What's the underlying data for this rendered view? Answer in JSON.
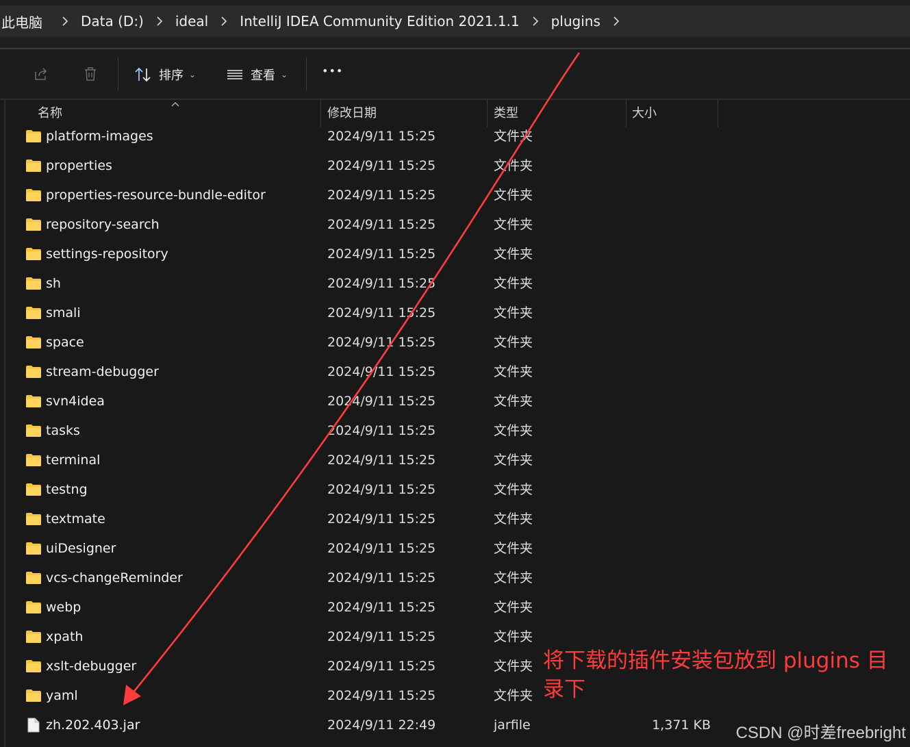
{
  "breadcrumb": [
    "此电脑",
    "Data (D:)",
    "ideal",
    "IntelliJ IDEA Community Edition 2021.1.1",
    "plugins"
  ],
  "toolbar": {
    "sort_label": "排序",
    "view_label": "查看",
    "more_label": "•••"
  },
  "columns": {
    "name": "名称",
    "date": "修改日期",
    "type": "类型",
    "size": "大小"
  },
  "files": [
    {
      "name": "platform-images",
      "date": "2024/9/11 15:25",
      "type": "文件夹",
      "size": "",
      "icon": "folder-icon"
    },
    {
      "name": "properties",
      "date": "2024/9/11 15:25",
      "type": "文件夹",
      "size": "",
      "icon": "folder-icon"
    },
    {
      "name": "properties-resource-bundle-editor",
      "date": "2024/9/11 15:25",
      "type": "文件夹",
      "size": "",
      "icon": "folder-icon"
    },
    {
      "name": "repository-search",
      "date": "2024/9/11 15:25",
      "type": "文件夹",
      "size": "",
      "icon": "folder-icon"
    },
    {
      "name": "settings-repository",
      "date": "2024/9/11 15:25",
      "type": "文件夹",
      "size": "",
      "icon": "folder-icon"
    },
    {
      "name": "sh",
      "date": "2024/9/11 15:25",
      "type": "文件夹",
      "size": "",
      "icon": "folder-icon"
    },
    {
      "name": "smali",
      "date": "2024/9/11 15:25",
      "type": "文件夹",
      "size": "",
      "icon": "folder-icon"
    },
    {
      "name": "space",
      "date": "2024/9/11 15:25",
      "type": "文件夹",
      "size": "",
      "icon": "folder-icon"
    },
    {
      "name": "stream-debugger",
      "date": "2024/9/11 15:25",
      "type": "文件夹",
      "size": "",
      "icon": "folder-icon"
    },
    {
      "name": "svn4idea",
      "date": "2024/9/11 15:25",
      "type": "文件夹",
      "size": "",
      "icon": "folder-icon"
    },
    {
      "name": "tasks",
      "date": "2024/9/11 15:25",
      "type": "文件夹",
      "size": "",
      "icon": "folder-icon"
    },
    {
      "name": "terminal",
      "date": "2024/9/11 15:25",
      "type": "文件夹",
      "size": "",
      "icon": "folder-icon"
    },
    {
      "name": "testng",
      "date": "2024/9/11 15:25",
      "type": "文件夹",
      "size": "",
      "icon": "folder-icon"
    },
    {
      "name": "textmate",
      "date": "2024/9/11 15:25",
      "type": "文件夹",
      "size": "",
      "icon": "folder-icon"
    },
    {
      "name": "uiDesigner",
      "date": "2024/9/11 15:25",
      "type": "文件夹",
      "size": "",
      "icon": "folder-icon"
    },
    {
      "name": "vcs-changeReminder",
      "date": "2024/9/11 15:25",
      "type": "文件夹",
      "size": "",
      "icon": "folder-icon"
    },
    {
      "name": "webp",
      "date": "2024/9/11 15:25",
      "type": "文件夹",
      "size": "",
      "icon": "folder-icon"
    },
    {
      "name": "xpath",
      "date": "2024/9/11 15:25",
      "type": "文件夹",
      "size": "",
      "icon": "folder-icon"
    },
    {
      "name": "xslt-debugger",
      "date": "2024/9/11 15:25",
      "type": "文件夹",
      "size": "",
      "icon": "folder-icon"
    },
    {
      "name": "yaml",
      "date": "2024/9/11 15:25",
      "type": "文件夹",
      "size": "",
      "icon": "folder-icon"
    },
    {
      "name": "zh.202.403.jar",
      "date": "2024/9/11 22:49",
      "type": "jarfile",
      "size": "1,371 KB",
      "icon": "file-icon"
    }
  ],
  "annotation": "将下载的插件安装包放到 plugins 目录下",
  "watermark": "CSDN @时差freebright",
  "colors": {
    "background": "#191919",
    "folder": "#f5c542",
    "annotation": "#ff3b3b"
  }
}
